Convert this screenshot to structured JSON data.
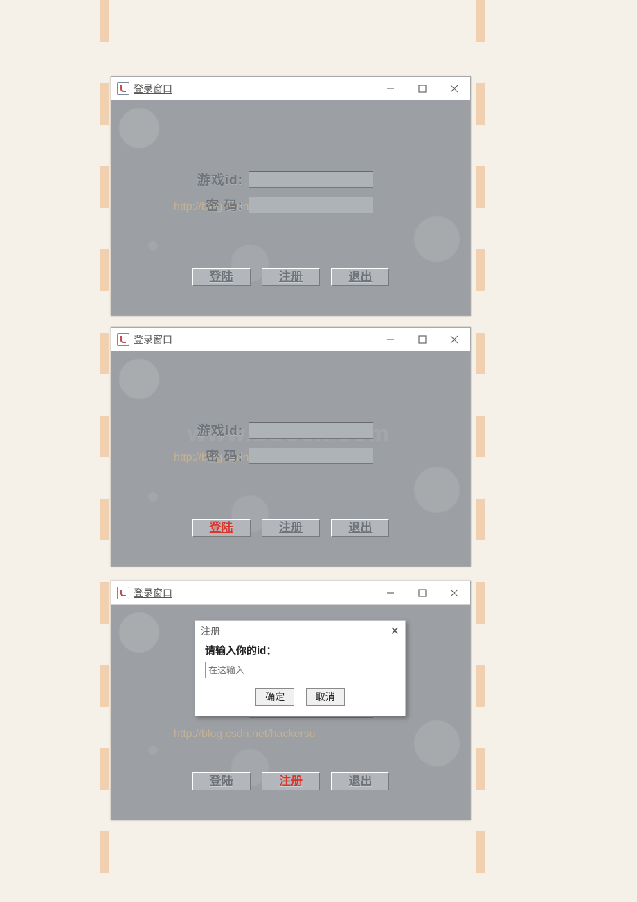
{
  "window_title": "登录窗口",
  "labels": {
    "game_id": "游戏id:",
    "password": "密  码:"
  },
  "buttons": {
    "login": "登陆",
    "register": "注册",
    "exit": "退出"
  },
  "modal": {
    "title": "注册",
    "prompt": "请输入你的id：",
    "placeholder": "在这输入",
    "ok": "确定",
    "cancel": "取消"
  },
  "watermark_url": "http://blog.csdn.net/hackersu",
  "watermark_big": "www.bdocx.com",
  "screens": [
    {
      "highlight": null,
      "show_modal": false
    },
    {
      "highlight": "login",
      "show_modal": false
    },
    {
      "highlight": "register",
      "show_modal": true
    }
  ]
}
